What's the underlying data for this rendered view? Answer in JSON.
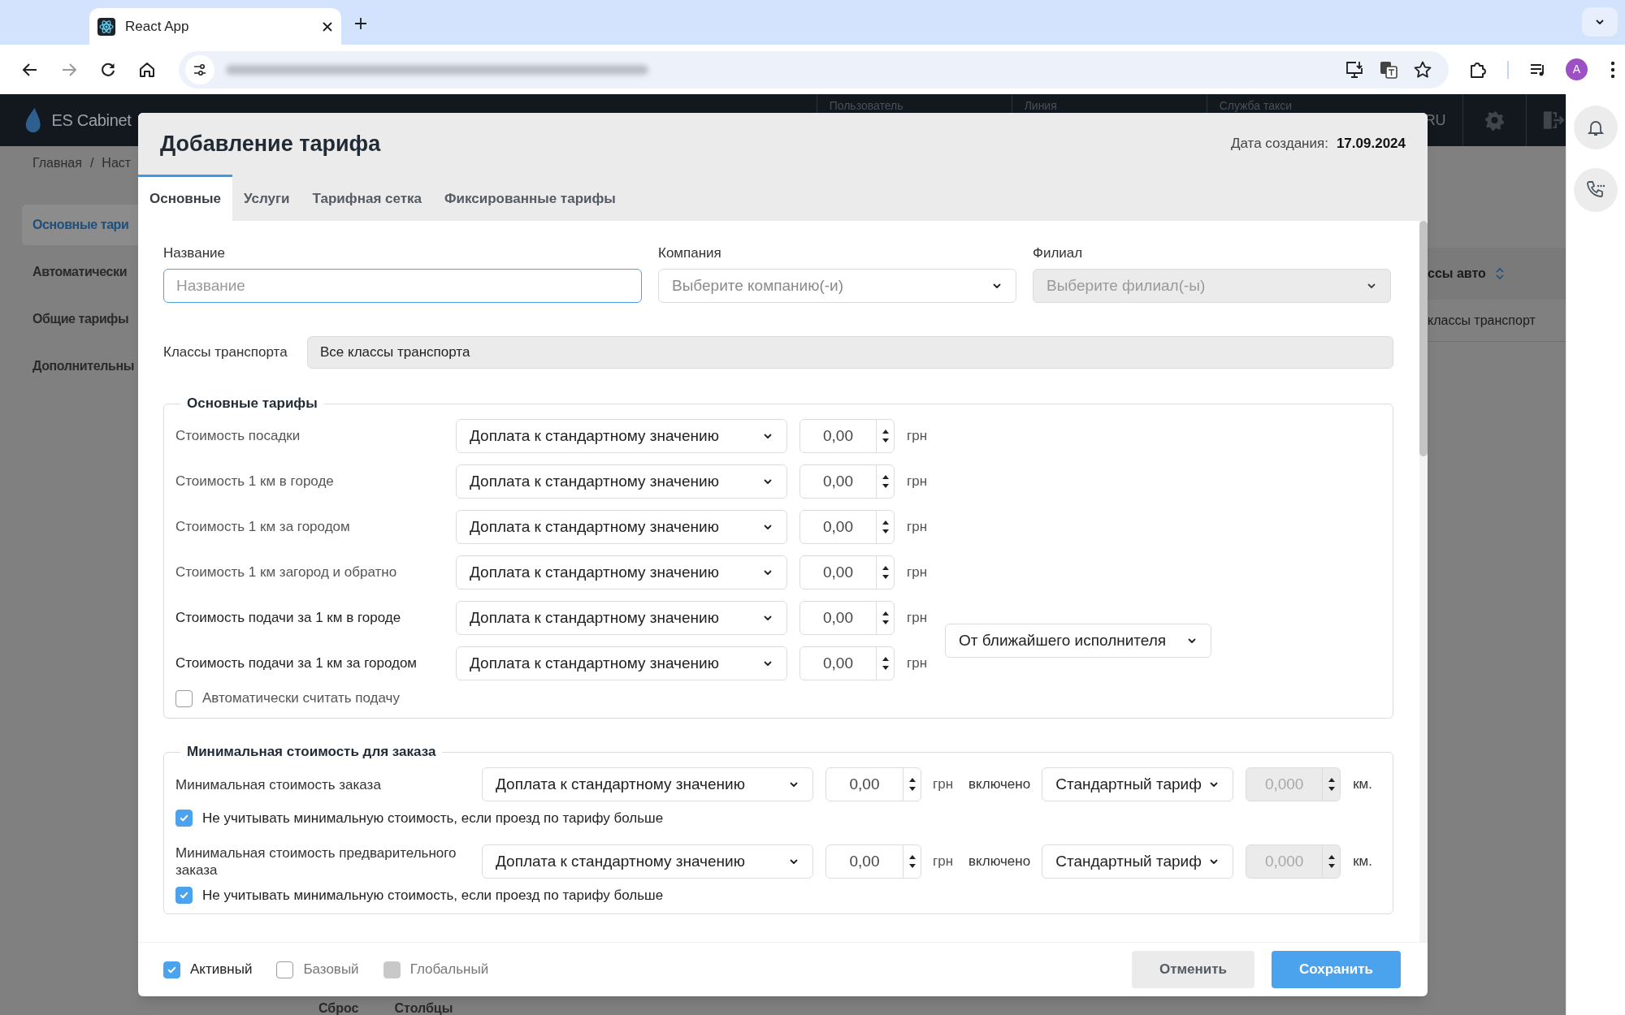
{
  "browser": {
    "tab_title": "React App",
    "avatar": "A"
  },
  "app": {
    "logo": "ES Cabinet",
    "header_columns": [
      "Пользователь",
      "Линия",
      "Служба такси"
    ],
    "language": "RU",
    "breadcrumb": [
      "Главная",
      "/",
      "Наст"
    ],
    "sidebar": [
      {
        "label": "Основные тари",
        "selected": true
      },
      {
        "label": "Автоматически",
        "selected": false
      },
      {
        "label": "Общие тарифы",
        "selected": false
      },
      {
        "label": "Дополнительны",
        "selected": false
      }
    ],
    "table_header": "ссы авто",
    "table_cell": "классы транспорт",
    "toolbar": [
      "Сброс",
      "Столбцы"
    ]
  },
  "modal": {
    "title": "Добавление тарифа",
    "created_label": "Дата создания:",
    "created_date": "17.09.2024",
    "tabs": [
      {
        "label": "Основные",
        "selected": true
      },
      {
        "label": "Услуги",
        "selected": false
      },
      {
        "label": "Тарифная сетка",
        "selected": false
      },
      {
        "label": "Фиксированные тарифы",
        "selected": false
      }
    ],
    "fields": [
      {
        "label": "Название",
        "placeholder": "Название",
        "kind": "text",
        "disabled": false
      },
      {
        "label": "Компания",
        "placeholder": "Выберите компанию(-и)",
        "kind": "select",
        "disabled": false
      },
      {
        "label": "Филиал",
        "placeholder": "Выберите филиал(-ы)",
        "kind": "select",
        "disabled": true
      }
    ],
    "transport": {
      "label": "Классы транспорта",
      "value": "Все классы транспорта"
    },
    "base_tariffs": {
      "legend": "Основные тарифы",
      "rows": [
        {
          "label": "Стоимость посадки",
          "mode": "Доплата к стандартному значению",
          "amount": "0,00",
          "unit": "грн"
        },
        {
          "label": "Стоимость 1 км в городе",
          "mode": "Доплата к стандартному значению",
          "amount": "0,00",
          "unit": "грн"
        },
        {
          "label": "Стоимость 1 км за городом",
          "mode": "Доплата к стандартному значению",
          "amount": "0,00",
          "unit": "грн"
        },
        {
          "label": "Стоимость 1 км загород и обратно",
          "mode": "Доплата к стандартному значению",
          "amount": "0,00",
          "unit": "грн"
        },
        {
          "label": "Стоимость подачи за 1 км в городе",
          "mode": "Доплата к стандартному значению",
          "amount": "0,00",
          "unit": "грн"
        },
        {
          "label": "Стоимость подачи за 1 км за городом",
          "mode": "Доплата к стандартному значению",
          "amount": "0,00",
          "unit": "грн"
        }
      ],
      "feed_mode": "От ближайшего исполнителя",
      "auto_feed": {
        "label": "Автоматически считать подачу",
        "checked": false
      }
    },
    "min_cost": {
      "legend": "Минимальная стоимость для заказа",
      "rows": [
        {
          "label": "Минимальная стоимость заказа",
          "mode": "Доплата к стандартному значению",
          "amount": "0,00",
          "unit": "грн",
          "included": "включено",
          "tariff": "Стандартный тариф",
          "distance": "0,000",
          "distance_unit": "км.",
          "ignore": {
            "label": "Не учитывать минимальную стоимость, если проезд по тарифу больше",
            "checked": true
          }
        },
        {
          "label": "Минимальная стоимость предварительного заказа",
          "mode": "Доплата к стандартному значению",
          "amount": "0,00",
          "unit": "грн",
          "included": "включено",
          "tariff": "Стандартный тариф",
          "distance": "0,000",
          "distance_unit": "км.",
          "ignore": {
            "label": "Не учитывать минимальную стоимость, если проезд по тарифу больше",
            "checked": true
          }
        }
      ]
    },
    "flags": [
      {
        "label": "Активный",
        "checked": true,
        "disabled": false
      },
      {
        "label": "Базовый",
        "checked": false,
        "disabled": false
      },
      {
        "label": "Глобальный",
        "checked": false,
        "disabled": true
      }
    ],
    "buttons": [
      {
        "label": "Отменить",
        "kind": "secondary"
      },
      {
        "label": "Сохранить",
        "kind": "primary"
      }
    ]
  }
}
